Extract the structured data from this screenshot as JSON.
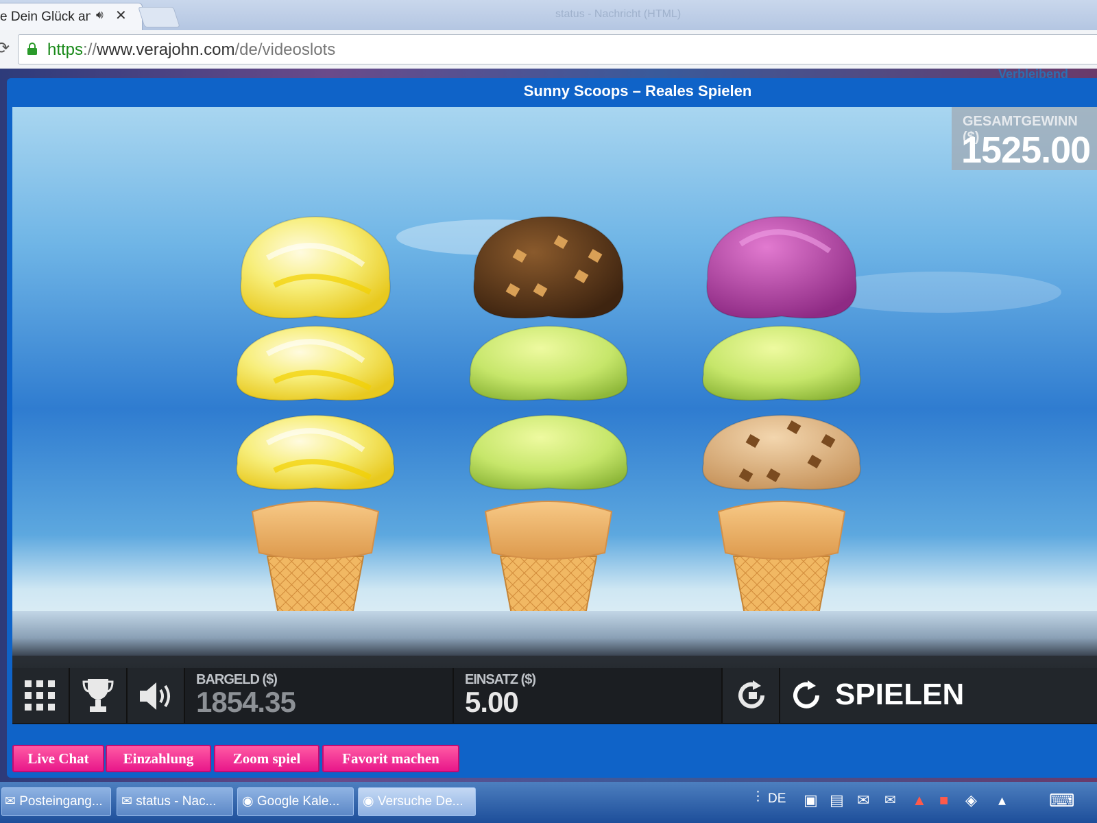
{
  "browser": {
    "tab_title": "e Dein Glück an",
    "window_title": "status - Nachricht (HTML)",
    "url": {
      "scheme": "https",
      "sep": "://",
      "host": "www.verajohn.com",
      "path": "/de/videoslots"
    }
  },
  "page": {
    "side_text": "Verbleibend"
  },
  "game": {
    "title": "Sunny Scoops – Reales Spielen",
    "total_win": {
      "label": "GESAMTGEWINN ($)",
      "value": "1525.00"
    },
    "cash": {
      "label": "BARGELD ($)",
      "value": "1854.35"
    },
    "bet": {
      "label": "EINSATZ ($)",
      "value": "5.00"
    },
    "spin_label": "SPIELEN",
    "cones": [
      {
        "scoops": [
          "lemon-swirl",
          "lemon-swirl",
          "lemon-swirl"
        ]
      },
      {
        "scoops": [
          "chocolate-chip",
          "lime",
          "lime"
        ]
      },
      {
        "scoops": [
          "berry",
          "lime",
          "cookie-dough"
        ]
      }
    ]
  },
  "actions": {
    "live_chat": "Live Chat",
    "deposit": "Einzahlung",
    "zoom": "Zoom spiel",
    "favorite": "Favorit machen"
  },
  "taskbar": {
    "items": [
      "Posteingang...",
      "status - Nac...",
      "Google Kale...",
      "Versuche De..."
    ],
    "language": "DE"
  },
  "colors": {
    "accent": "#0f63c8",
    "pink": "#e8178a",
    "lemon": "#f5e84a",
    "chocolate": "#6b4420",
    "lime": "#c6e66a",
    "berry": "#c14fae",
    "cookie": "#e2b98a",
    "cone": "#f0b66a"
  }
}
